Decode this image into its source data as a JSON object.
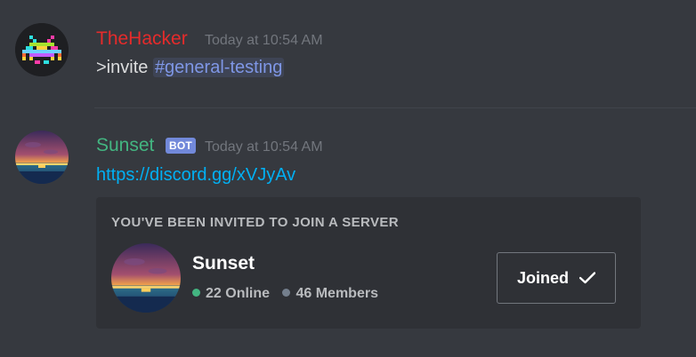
{
  "messages": [
    {
      "username": "TheHacker",
      "username_color": "#e62b2b",
      "timestamp": "Today at 10:54 AM",
      "text_prefix": ">invite ",
      "mention": "#general-testing",
      "avatar_icon": "space-invader-icon"
    },
    {
      "username": "Sunset",
      "username_color": "#43b581",
      "bot_tag": "BOT",
      "timestamp": "Today at 10:54 AM",
      "link": "https://discord.gg/xVJyAv",
      "avatar_icon": "sunset-icon"
    }
  ],
  "invite": {
    "header": "YOU'VE BEEN INVITED TO JOIN A SERVER",
    "server_name": "Sunset",
    "online": "22 Online",
    "members": "46 Members",
    "online_color": "#43b581",
    "members_color": "#747f8d",
    "button_label": "Joined",
    "button_icon": "check-icon"
  }
}
